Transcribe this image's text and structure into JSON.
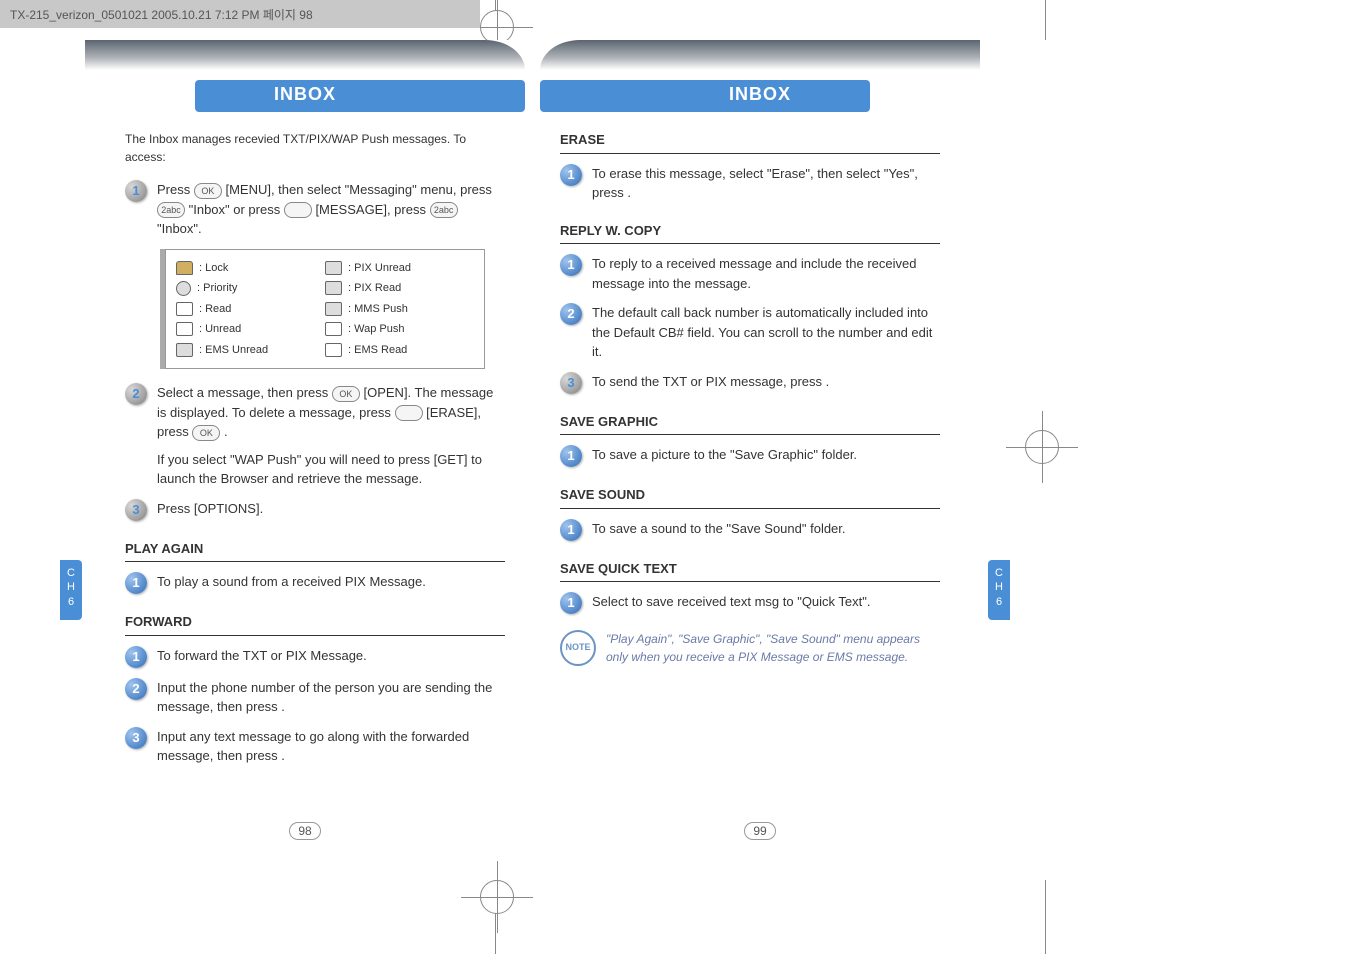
{
  "doc_header": "TX-215_verizon_0501021  2005.10.21  7:12 PM  페이지 98",
  "side_tab": {
    "line1": "C",
    "line2": "H",
    "line3": "6"
  },
  "left": {
    "title": "INBOX",
    "intro": "The Inbox manages recevied TXT/PIX/WAP Push messages. To access:",
    "step1_a": "Press ",
    "step1_key1": "OK",
    "step1_b": " [MENU], then select \"Messaging\" menu, press ",
    "step1_key2": "2abc",
    "step1_c": " \"Inbox\" or press ",
    "step1_d": " [MESSAGE], press ",
    "step1_key3": "2abc",
    "step1_e": " \"Inbox\".",
    "legend": [
      {
        "l": ": Lock",
        "r": ": PIX Unread"
      },
      {
        "l": ": Priority",
        "r": ": PIX Read"
      },
      {
        "l": ": Read",
        "r": ": MMS Push"
      },
      {
        "l": ": Unread",
        "r": ": Wap Push"
      },
      {
        "l": ": EMS Unread",
        "r": ": EMS Read"
      }
    ],
    "step2_a": "Select a message, then press ",
    "step2_b": " [OPEN]. The message is displayed. To delete a message, press ",
    "step2_c": " [ERASE], press ",
    "step2_d": " .",
    "step2_p2": "If you select \"WAP Push\" you will need to press      [GET] to launch the Browser and retrieve the message.",
    "step3": "Press      [OPTIONS].",
    "play_head": "PLAY AGAIN",
    "play_1": "To play a sound from a received PIX Message.",
    "fwd_head": "FORWARD",
    "fwd_1": "To forward the TXT or PIX Message.",
    "fwd_2": "Input the phone number of the person you are sending the message, then press       .",
    "fwd_3": "Input any text message to go along with the forwarded message, then press       .",
    "page_num": "98"
  },
  "right": {
    "title": "INBOX",
    "erase_head": "ERASE",
    "erase_1": "To erase this message, select \"Erase\", then select \"Yes\", press       .",
    "reply_head": "REPLY W. COPY",
    "reply_1": "To reply to a received message and include the received message into the message.",
    "reply_2": "The default call back number is automatically included into the Default CB# field. You can scroll to the number and edit it.",
    "reply_3": "To send the TXT or PIX message, press       .",
    "sg_head": "SAVE GRAPHIC",
    "sg_1": "To save a picture to the \"Save Graphic\" folder.",
    "ss_head": "SAVE SOUND",
    "ss_1": "To save a sound to the \"Save Sound\" folder.",
    "sqt_head": "SAVE QUICK TEXT",
    "sqt_1": "Select to save received text msg to \"Quick Text\".",
    "note_badge": "NOTE",
    "note": "\"Play Again\", \"Save Graphic\", \"Save Sound\" menu appears only when you receive a PIX Message or EMS message.",
    "page_num": "99"
  }
}
